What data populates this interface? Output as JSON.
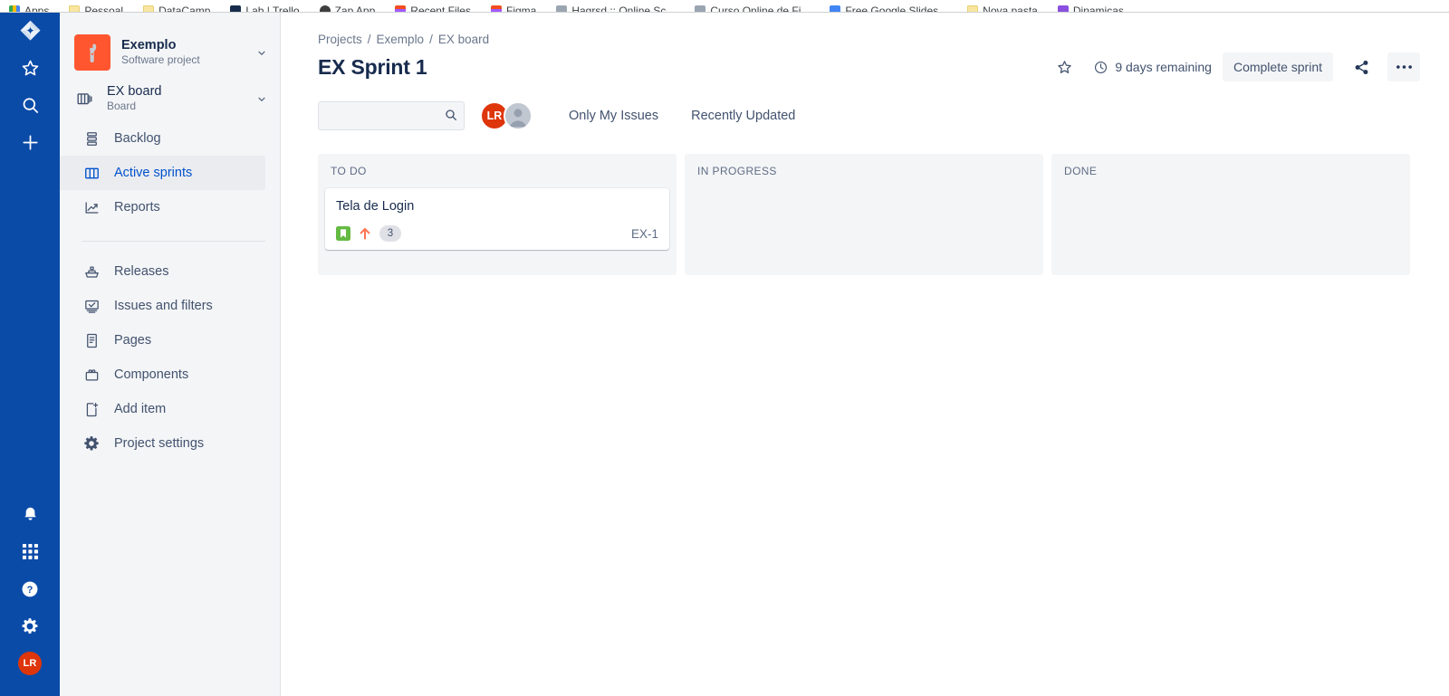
{
  "browser": {
    "bookmarks": [
      {
        "label": "Apps",
        "icon": "apps-grid-icon",
        "icon_class": "ico-apps"
      },
      {
        "label": "Pessoal",
        "icon": "folder-icon",
        "icon_class": "ico-folder"
      },
      {
        "label": "DataCamp",
        "icon": "folder-icon",
        "icon_class": "ico-folder"
      },
      {
        "label": "Lab | Trello",
        "icon": "trello-icon",
        "icon_class": "ico-trello"
      },
      {
        "label": "Zap App",
        "icon": "zap-app-icon",
        "icon_class": "ico-zap"
      },
      {
        "label": "Recent Files",
        "icon": "figma-icon",
        "icon_class": "ico-figma"
      },
      {
        "label": "Figma",
        "icon": "figma-icon",
        "icon_class": "ico-figma"
      },
      {
        "label": "Hagrsd :: Online Sc...",
        "icon": "image-icon",
        "icon_class": "ico-img"
      },
      {
        "label": "Curso Online de Fi...",
        "icon": "image-icon",
        "icon_class": "ico-img"
      },
      {
        "label": "Free Google Slides...",
        "icon": "slides-icon",
        "icon_class": "ico-slides"
      },
      {
        "label": "Nova pasta",
        "icon": "folder-icon",
        "icon_class": "ico-folder"
      },
      {
        "label": "Dinamicas",
        "icon": "purple-app-icon",
        "icon_class": "ico-purple"
      }
    ]
  },
  "nav_rail": {
    "items": [
      {
        "name": "jira-logo",
        "label": "Jira"
      },
      {
        "name": "starred-icon",
        "label": "Starred"
      },
      {
        "name": "search-icon",
        "label": "Search"
      },
      {
        "name": "create-icon",
        "label": "Create"
      }
    ],
    "bottom_items": [
      {
        "name": "notifications-icon",
        "label": "Notifications"
      },
      {
        "name": "app-switcher-icon",
        "label": "App switcher"
      },
      {
        "name": "help-icon",
        "label": "Help"
      },
      {
        "name": "settings-icon",
        "label": "Settings"
      }
    ],
    "avatar_initials": "LR"
  },
  "sidebar": {
    "project": {
      "name": "Exemplo",
      "type": "Software project",
      "avatar_icon": "wrench-icon",
      "avatar_color": "#ff5630"
    },
    "board": {
      "name": "EX board",
      "type": "Board",
      "icon": "board-icon"
    },
    "primary_items": [
      {
        "label": "Backlog",
        "icon": "backlog-icon",
        "selected": false
      },
      {
        "label": "Active sprints",
        "icon": "board-columns-icon",
        "selected": true
      },
      {
        "label": "Reports",
        "icon": "reports-chart-icon",
        "selected": false
      }
    ],
    "secondary_items": [
      {
        "label": "Releases",
        "icon": "releases-ship-icon"
      },
      {
        "label": "Issues and filters",
        "icon": "issues-filters-icon"
      },
      {
        "label": "Pages",
        "icon": "pages-document-icon"
      },
      {
        "label": "Components",
        "icon": "components-icon"
      },
      {
        "label": "Add item",
        "icon": "add-item-icon"
      },
      {
        "label": "Project settings",
        "icon": "project-settings-gear-icon"
      }
    ]
  },
  "header": {
    "breadcrumb": [
      "Projects",
      "Exemplo",
      "EX board"
    ],
    "breadcrumb_separator": "/",
    "title": "EX Sprint 1",
    "star_icon": "star-icon",
    "clock_icon": "clock-icon",
    "days_remaining": "9 days remaining",
    "complete_sprint_label": "Complete sprint",
    "share_icon": "share-icon",
    "more_icon": "more-options-icon",
    "more_label": "•••"
  },
  "toolbar": {
    "search_value": "",
    "search_placeholder": "",
    "search_icon": "search-icon",
    "avatars": [
      {
        "name": "avatar-lr",
        "initials": "LR",
        "color": "#de350b"
      },
      {
        "name": "avatar-unassigned",
        "initials": "",
        "color": "#c1c7d0"
      }
    ],
    "filters": [
      {
        "label": "Only My Issues",
        "name": "filter-only-my-issues"
      },
      {
        "label": "Recently Updated",
        "name": "filter-recently-updated"
      }
    ]
  },
  "board": {
    "columns": [
      {
        "title": "TO DO",
        "cards": [
          {
            "summary": "Tela de Login",
            "issue_type": "story",
            "issue_type_color": "#65ba43",
            "priority": "high",
            "priority_color": "#ff7452",
            "story_points": "3",
            "key": "EX-1"
          }
        ]
      },
      {
        "title": "IN PROGRESS",
        "cards": []
      },
      {
        "title": "DONE",
        "cards": []
      }
    ]
  },
  "colors": {
    "rail_blue": "#0b4ba8",
    "sidebar_bg": "#f4f5f7",
    "link_blue": "#0052cc",
    "text_dark": "#172b4d",
    "text_muted": "#6b778c"
  }
}
